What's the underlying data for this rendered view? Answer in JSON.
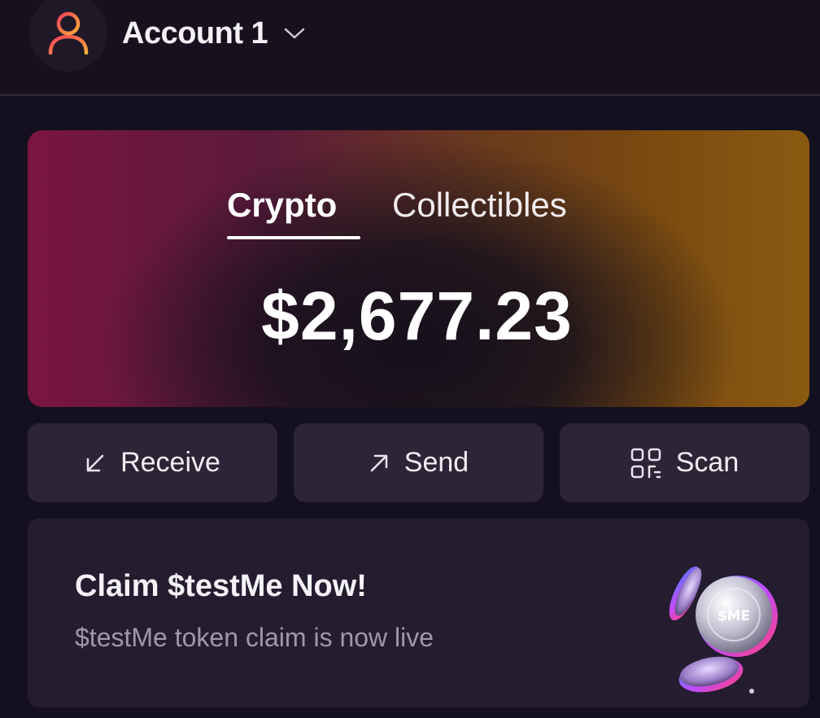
{
  "header": {
    "account_name": "Account 1",
    "avatar_icon": "user-icon",
    "chevron_icon": "chevron-down-icon"
  },
  "balance_card": {
    "tabs": [
      {
        "label": "Crypto",
        "active": true
      },
      {
        "label": "Collectibles",
        "active": false
      }
    ],
    "amount": "$2,677.23"
  },
  "actions": [
    {
      "label": "Receive",
      "icon": "arrow-down-left-icon"
    },
    {
      "label": "Send",
      "icon": "arrow-up-right-icon"
    },
    {
      "label": "Scan",
      "icon": "qr-scan-icon"
    }
  ],
  "promo": {
    "title": "Claim $testMe Now!",
    "subtitle": "$testMe token claim is now live",
    "coin_text": "$ME"
  },
  "colors": {
    "background": "#15101f",
    "button": "#2c2537",
    "promo": "#241d30",
    "avatar_gradient_start": "#ff3d5a",
    "avatar_gradient_end": "#ffb13b"
  }
}
